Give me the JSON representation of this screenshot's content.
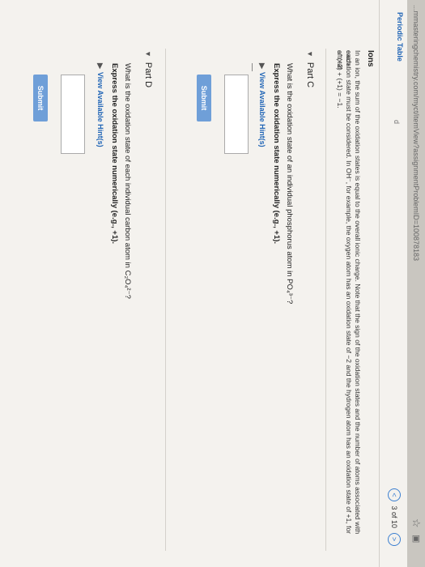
{
  "browser": {
    "url": "...mmasteringchemistry.com/myct/itemView?assignmentProblemID=100878183",
    "star_icon": "star-icon",
    "bookmark_icon": "bookmark-icon"
  },
  "sidebar": {
    "tab_label": "Periodic Table",
    "stub": "d"
  },
  "pager": {
    "prev": "<",
    "position": "3 of 10",
    "next": ">"
  },
  "ions": {
    "title": "Ions",
    "text_1": "In an ion, the sum of the oxidation states is equal to the overall ionic charge. Note that the sign of the oxidation states and the number of atoms associated with each",
    "text_2": "oxidation state must be considered. In OH⁻, for example, the oxygen atom has an oxidation state of −2 and the hydrogen atom has an oxidation state of +1, for a total",
    "text_3": "of (−2) + (+1) = −1."
  },
  "part_c": {
    "label": "Part C",
    "question": "What is the oxidation state of an individual phosphorus atom in PO₄³⁻?",
    "instruction": "Express the oxidation state numerically (e.g., +1).",
    "hints": "View Available Hint(s)",
    "answer_value": "",
    "submit": "Submit"
  },
  "part_d": {
    "label": "Part D",
    "question": "What is the oxidation state of each individual carbon atom in C₂O₄²⁻?",
    "instruction": "Express the oxidation state numerically (e.g., +1).",
    "hints": "View Available Hint(s)",
    "answer_value": "",
    "submit": "Submit"
  }
}
